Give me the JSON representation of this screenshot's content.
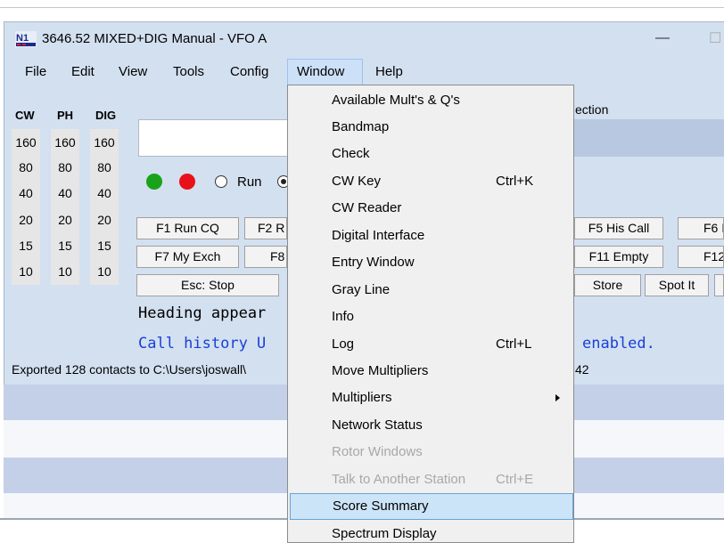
{
  "window": {
    "title": "3646.52 MIXED+DIG Manual - VFO A",
    "minimize_glyph": "—",
    "maximize_glyph": "☐",
    "app_icon": "n1mm-logo-icon"
  },
  "menubar": {
    "items": [
      "File",
      "Edit",
      "View",
      "Tools",
      "Config",
      "Window",
      "Help"
    ],
    "active": "Window"
  },
  "bands": {
    "headers": [
      "CW",
      "PH",
      "DIG"
    ],
    "rows": [
      [
        "160",
        "160",
        "160"
      ],
      [
        "80",
        "80",
        "80"
      ],
      [
        "40",
        "40",
        "40"
      ],
      [
        "20",
        "20",
        "20"
      ],
      [
        "15",
        "15",
        "15"
      ],
      [
        "10",
        "10",
        "10"
      ]
    ]
  },
  "right_header_fragment": "ection",
  "mode": {
    "run_label": "Run",
    "run_dot_color": "#1aa31a",
    "stop_dot_color": "#e8101a"
  },
  "fkeys": {
    "row1": [
      "F1 Run CQ",
      "F2 R",
      "F5 His Call",
      "F6 I"
    ],
    "row2": [
      "F7 My Exch",
      "F8",
      "F11 Empty",
      "F12"
    ],
    "row3": [
      "Esc: Stop",
      "Store",
      "Spot It"
    ]
  },
  "info_lines": {
    "heading": "Heading appear",
    "call_history": "Call history U",
    "enabled": "enabled."
  },
  "status": {
    "text": "Exported 128 contacts to C:\\Users\\joswall\\",
    "fragment": "42"
  },
  "window_menu": {
    "items": [
      {
        "label": "Available Mult's & Q's",
        "shortcut": "",
        "disabled": false
      },
      {
        "label": "Bandmap",
        "shortcut": "",
        "disabled": false
      },
      {
        "label": "Check",
        "shortcut": "",
        "disabled": false
      },
      {
        "label": "CW Key",
        "shortcut": "Ctrl+K",
        "disabled": false
      },
      {
        "label": "CW Reader",
        "shortcut": "",
        "disabled": false
      },
      {
        "label": "Digital Interface",
        "shortcut": "",
        "disabled": false
      },
      {
        "label": "Entry Window",
        "shortcut": "",
        "disabled": false
      },
      {
        "label": "Gray Line",
        "shortcut": "",
        "disabled": false
      },
      {
        "label": "Info",
        "shortcut": "",
        "disabled": false
      },
      {
        "label": "Log",
        "shortcut": "Ctrl+L",
        "disabled": false
      },
      {
        "label": "Move Multipliers",
        "shortcut": "",
        "disabled": false
      },
      {
        "label": "Multipliers",
        "shortcut": "",
        "disabled": false,
        "submenu": true
      },
      {
        "label": "Network Status",
        "shortcut": "",
        "disabled": false
      },
      {
        "label": "Rotor Windows",
        "shortcut": "",
        "disabled": true
      },
      {
        "label": "Talk to Another Station",
        "shortcut": "Ctrl+E",
        "disabled": true
      },
      {
        "label": "Score Summary",
        "shortcut": "",
        "disabled": false,
        "highlighted": true
      },
      {
        "label": "Spectrum Display",
        "shortcut": "",
        "disabled": false
      }
    ]
  }
}
